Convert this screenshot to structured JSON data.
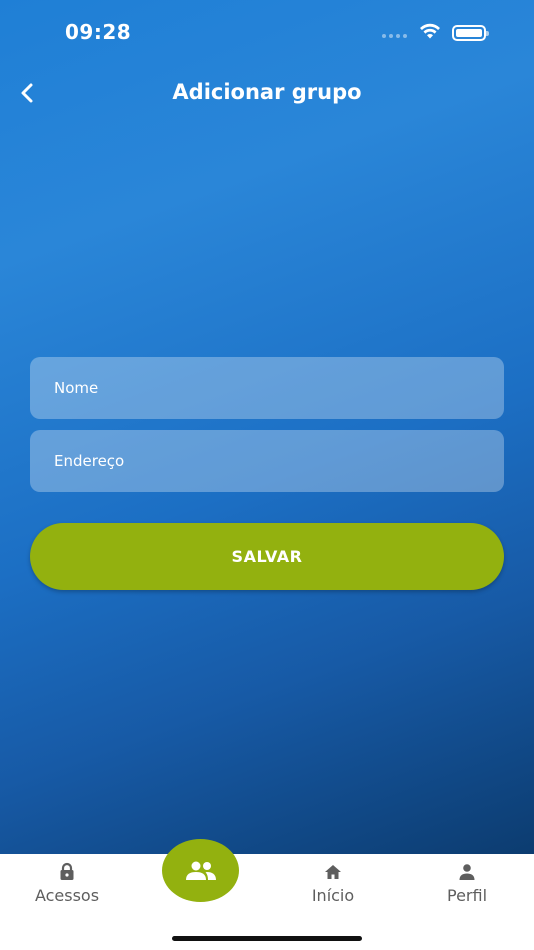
{
  "status_bar": {
    "time": "09:28"
  },
  "header": {
    "title": "Adicionar grupo",
    "back_icon": "chevron-left-icon"
  },
  "form": {
    "name_placeholder": "Nome",
    "address_placeholder": "Endereço",
    "save_label": "SALVAR"
  },
  "tab_bar": {
    "items": [
      {
        "label": "Acessos",
        "icon": "lock-icon"
      },
      {
        "label": "",
        "icon": "group-icon",
        "active": true
      },
      {
        "label": "Início",
        "icon": "home-icon"
      },
      {
        "label": "Perfil",
        "icon": "person-icon"
      }
    ]
  },
  "colors": {
    "accent": "#93b10f",
    "background_top": "#2a86d8",
    "background_bottom": "#0c3c70",
    "tab_text": "#5e5e5e"
  }
}
